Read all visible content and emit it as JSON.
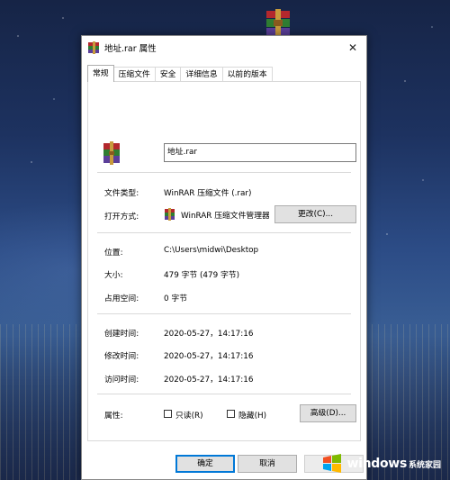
{
  "dialog": {
    "title": "地址.rar 属性",
    "close_glyph": "✕"
  },
  "tabs": [
    {
      "label": "常规",
      "active": true
    },
    {
      "label": "压缩文件",
      "active": false
    },
    {
      "label": "安全",
      "active": false
    },
    {
      "label": "详细信息",
      "active": false
    },
    {
      "label": "以前的版本",
      "active": false
    }
  ],
  "general": {
    "filename": "地址.rar",
    "file_type_label": "文件类型:",
    "file_type_value": "WinRAR 压缩文件 (.rar)",
    "opens_with_label": "打开方式:",
    "opens_with_value": "WinRAR 压缩文件管理器",
    "change_button": "更改(C)...",
    "location_label": "位置:",
    "location_value": "C:\\Users\\midwi\\Desktop",
    "size_label": "大小:",
    "size_value": "479 字节 (479 字节)",
    "size_on_disk_label": "占用空间:",
    "size_on_disk_value": "0 字节",
    "created_label": "创建时间:",
    "created_value": "2020-05-27，14:17:16",
    "modified_label": "修改时间:",
    "modified_value": "2020-05-27，14:17:16",
    "accessed_label": "访问时间:",
    "accessed_value": "2020-05-27，14:17:16",
    "attributes_label": "属性:",
    "readonly_label": "只读(R)",
    "readonly_checked": false,
    "hidden_label": "隐藏(H)",
    "hidden_checked": false,
    "advanced_button": "高级(D)..."
  },
  "footer": {
    "ok_button": "确定",
    "cancel_button": "取消"
  },
  "watermark": {
    "text": "windows",
    "subtext": "系统家园"
  },
  "icons": {
    "desktop_icon": "winrar-archive-icon",
    "title_icon": "winrar-archive-icon",
    "file_icon": "winrar-archive-icon",
    "app_icon": "winrar-archive-icon",
    "close_icon": "close-icon",
    "watermark_logo": "windows-logo-icon"
  },
  "colors": {
    "accent": "#0078d7",
    "button_bg": "#e1e1e1"
  }
}
